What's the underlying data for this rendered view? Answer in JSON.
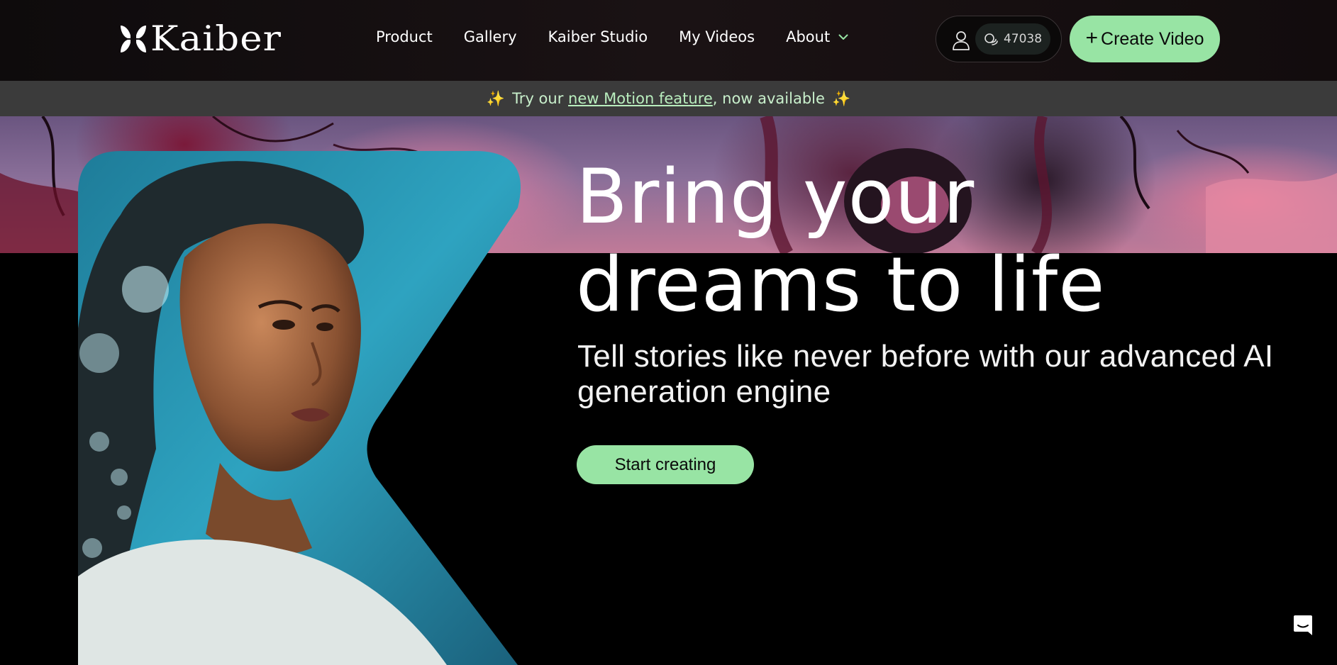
{
  "brand": {
    "name": "Kaiber"
  },
  "nav": {
    "items": [
      {
        "label": "Product"
      },
      {
        "label": "Gallery"
      },
      {
        "label": "Kaiber Studio"
      },
      {
        "label": "My Videos"
      },
      {
        "label": "About",
        "has_dropdown": true
      }
    ]
  },
  "account": {
    "credits": "47038",
    "user_icon": "user-icon",
    "credits_icon": "coins-icon"
  },
  "header": {
    "create_label": "Create Video",
    "create_icon": "plus-icon"
  },
  "announcement": {
    "sparkle": "✨",
    "prefix": "Try our ",
    "link_text": "new Motion feature",
    "suffix": ", now available"
  },
  "hero": {
    "headline_line1": "Bring your",
    "headline_line2": "dreams to life",
    "subtitle": "Tell stories like never before with our advanced AI generation engine",
    "cta_label": "Start creating"
  },
  "chat": {
    "icon": "chat-icon"
  },
  "colors": {
    "accent": "#98e4a4",
    "header_bg": "#140f10",
    "announcement_bg": "#3b3b3b",
    "announcement_text": "#c9f0cc",
    "page_bg": "#000000"
  }
}
